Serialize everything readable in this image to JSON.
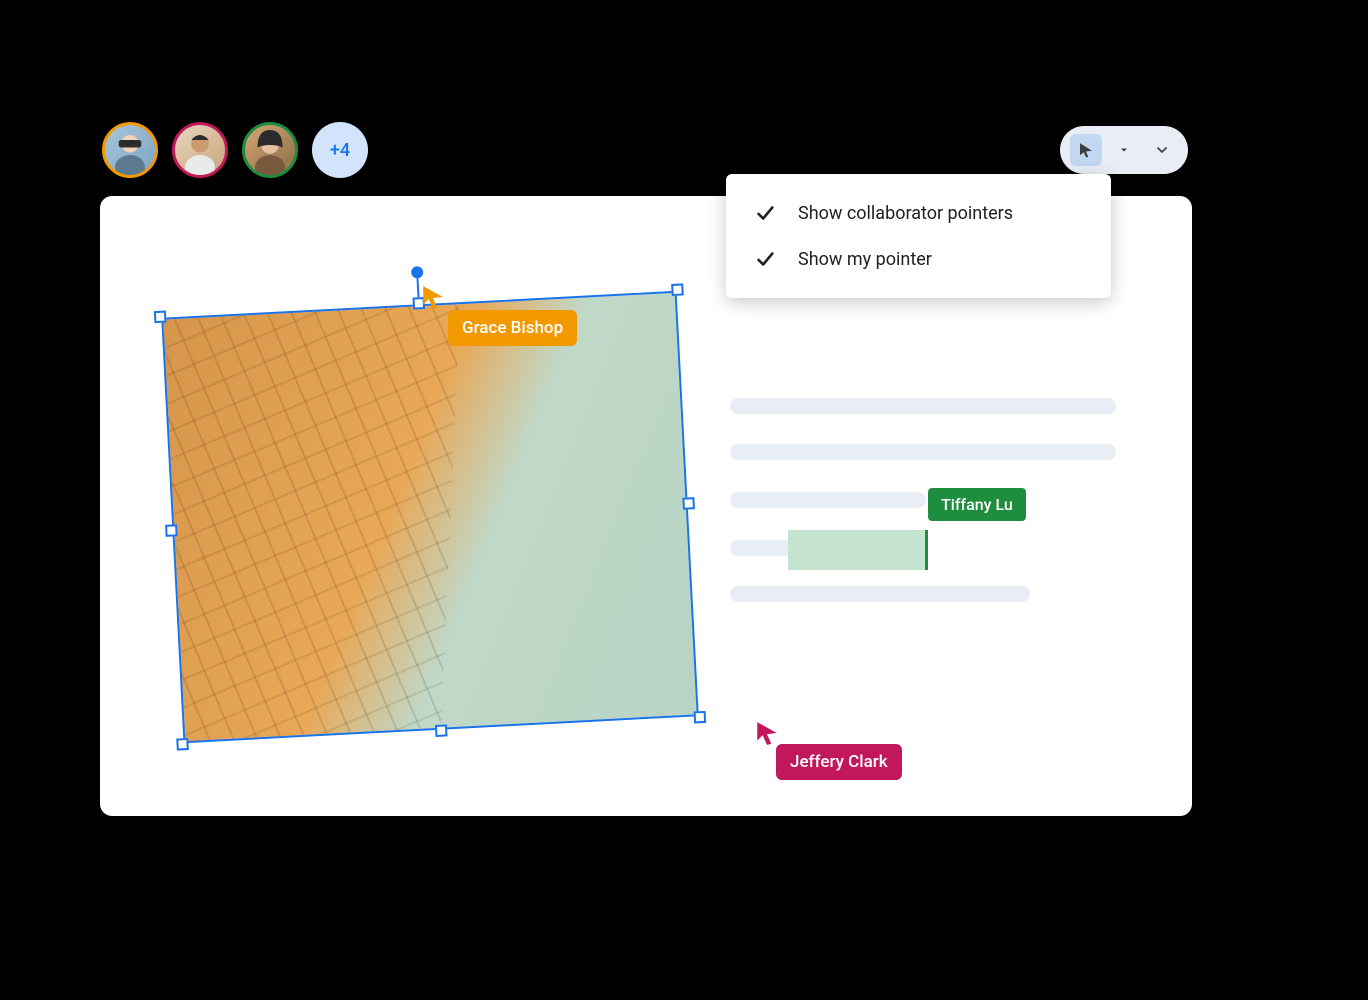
{
  "collaborators": {
    "overflow_count": "+4",
    "pointers": [
      {
        "name": "Grace Bishop",
        "color": "#f29900"
      },
      {
        "name": "Tiffany Lu",
        "color": "#1e8e3e"
      },
      {
        "name": "Jeffery Clark",
        "color": "#c2185b"
      }
    ]
  },
  "menu": {
    "items": [
      {
        "label": "Show collaborator pointers",
        "checked": true
      },
      {
        "label": "Show my pointer",
        "checked": true
      }
    ]
  }
}
